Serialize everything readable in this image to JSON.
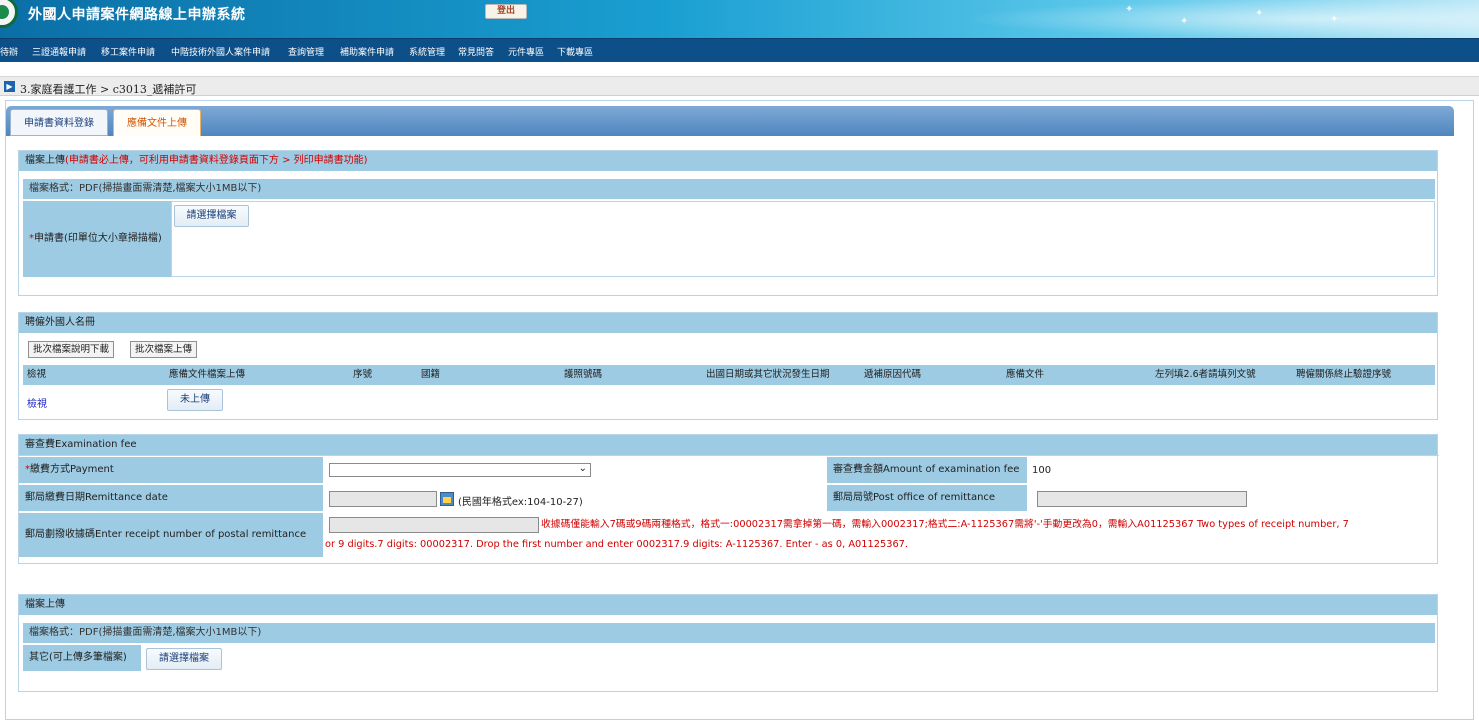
{
  "header": {
    "system_title": "外國人申請案件網路線上申辦系統",
    "logout_label": "登出"
  },
  "nav": {
    "items": [
      "待辦",
      "三證通報申請",
      "移工案件申請",
      "中階技術外國人案件申請",
      "查詢管理",
      "補助案件申請",
      "系統管理",
      "常見問答",
      "元件專區",
      "下載專區"
    ]
  },
  "breadcrumb": {
    "text": "3.家庭看護工作 > c3013_遞補許可"
  },
  "tabs": [
    {
      "label": "申請書資料登錄",
      "active": false
    },
    {
      "label": "應備文件上傳",
      "active": true
    }
  ],
  "upload_section": {
    "title_prefix": "檔案上傳",
    "title_note": "(申請書必上傳，可利用申請書資料登錄頁面下方 > 列印申請書功能)",
    "format_note": "檔案格式：PDF(掃描畫面需清楚,檔案大小1MB以下)",
    "required_mark": "*",
    "field_label": "申請書(印單位大小章掃描檔)",
    "choose_file_label": "請選擇檔案"
  },
  "roster_section": {
    "title": "聘僱外國人名冊",
    "batch_download_label": "批次檔案說明下載",
    "batch_upload_label": "批次檔案上傳",
    "columns": [
      "檢視",
      "應備文件檔案上傳",
      "序號",
      "國籍",
      "護照號碼",
      "出國日期或其它狀況發生日期",
      "遞補原因代碼",
      "應備文件",
      "左列填2.6者請填列文號",
      "聘僱關係終止驗證序號"
    ],
    "row": {
      "view_link": "檢視",
      "upload_status": "未上傳"
    }
  },
  "fee_section": {
    "title": "審查費Examination fee",
    "required_mark": "*",
    "payment_label": "繳費方式Payment",
    "amount_label": "審查費金額Amount of examination fee",
    "amount_value": "100",
    "remit_date_label": "郵局繳費日期Remittance date",
    "remit_date_hint": "(民國年格式ex:104-10-27)",
    "post_office_label": "郵局局號Post office of remittance",
    "receipt_label": "郵局劃撥收據碼Enter receipt number of postal remittance",
    "receipt_hint_line1": "收據碼僅能輸入7碼或9碼兩種格式，格式一:00002317需拿掉第一碼，需輸入0002317;格式二:A-1125367需將'-'手動更改為0，需輸入A01125367 Two types of receipt number, 7",
    "receipt_hint_line2": "or 9 digits.7 digits: 00002317. Drop the first number and enter 0002317.9 digits: A-1125367. Enter - as 0, A01125367."
  },
  "other_section": {
    "title": "檔案上傳",
    "format_note": "檔案格式：PDF(掃描畫面需清楚,檔案大小1MB以下)",
    "field_label": "其它(可上傳多筆檔案)",
    "choose_file_label": "請選擇檔案"
  },
  "colors": {
    "header_blue": "#1a9fd2",
    "nav_blue": "#0d4f88",
    "section_blue": "#9dcbe3",
    "required_red": "#d10000",
    "active_tab_orange": "#d35400"
  }
}
